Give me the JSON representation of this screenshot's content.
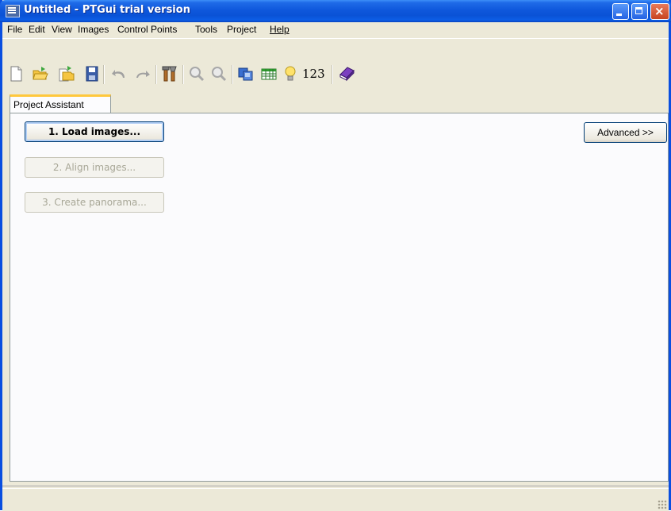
{
  "window": {
    "title": "Untitled - PTGui trial version",
    "colors": {
      "titlebar": "#0a52d6",
      "face": "#ece9d8",
      "panel": "#fbfbfd",
      "tab_highlight": "#ffc83c"
    }
  },
  "menu": {
    "file": "File",
    "edit": "Edit",
    "view": "View",
    "images": "Images",
    "control_points": "Control Points",
    "tools": "Tools",
    "project": "Project",
    "help": "Help"
  },
  "toolbar": {
    "icons": [
      "new-icon",
      "open-icon",
      "open-recent-icon",
      "save-icon",
      "undo-icon",
      "redo-icon",
      "tools-icon",
      "zoom-in-icon",
      "zoom-out-icon",
      "panorama-editor-icon",
      "table-icon",
      "lightbulb-icon",
      "numbers-icon",
      "help-book-icon"
    ],
    "numbers_label": "123"
  },
  "tabs": {
    "project_assistant": "Project Assistant"
  },
  "assistant": {
    "load_images": "1. Load images...",
    "align_images": "2. Align images...",
    "create_panorama": "3. Create panorama...",
    "advanced": "Advanced >>"
  }
}
